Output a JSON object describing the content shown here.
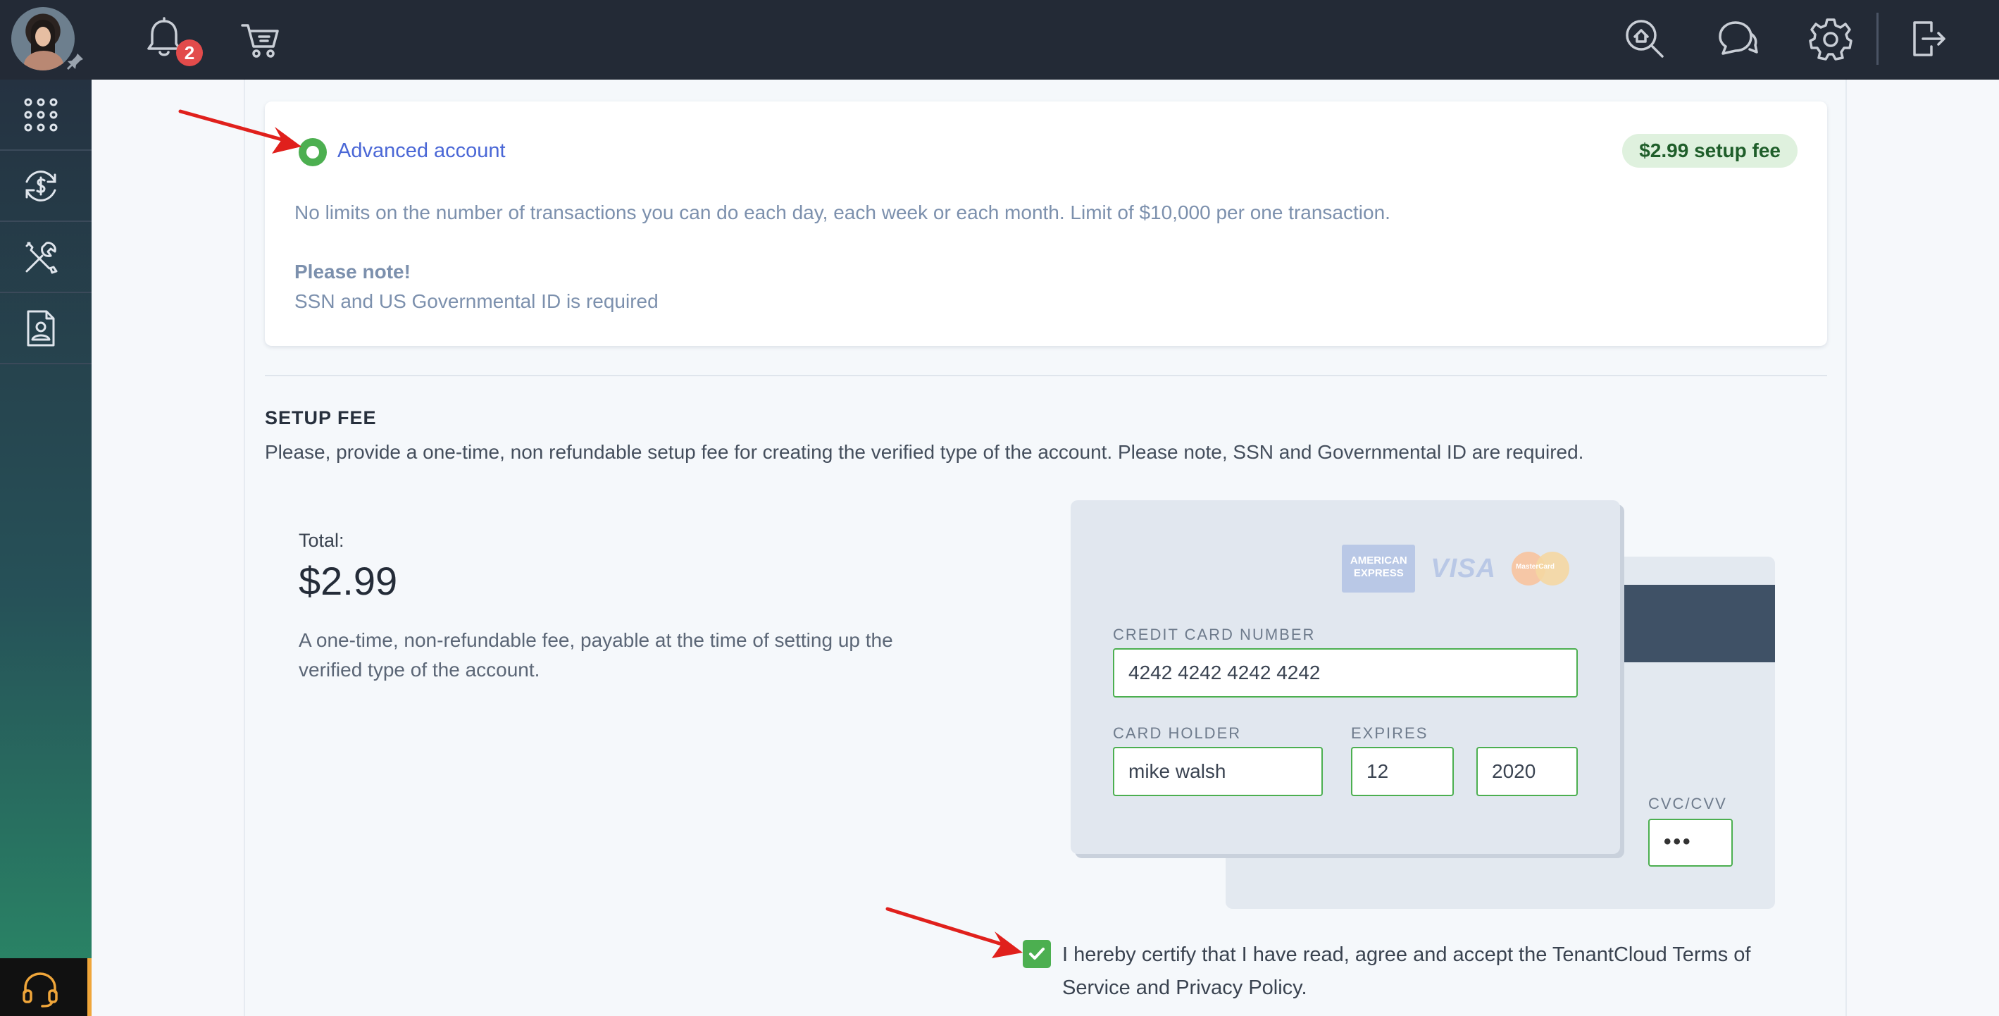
{
  "topbar": {
    "notification_count": "2",
    "icons": [
      "bell-icon",
      "cart-icon",
      "search-home-icon",
      "chat-icon",
      "gear-icon",
      "logout-icon"
    ]
  },
  "sidebar": {
    "items": [
      "apps-grid-icon",
      "payments-icon",
      "tools-icon",
      "tenant-document-icon"
    ],
    "help_icon": "headset-icon"
  },
  "account": {
    "title": "Advanced account",
    "fee_badge": "$2.99 setup fee",
    "description": "No limits on the number of transactions you can do each day, each week or each month. Limit of $10,000 per one transaction.",
    "note_title": "Please note!",
    "note_text": "SSN and US Governmental ID is required"
  },
  "setup_fee": {
    "title": "SETUP FEE",
    "description": "Please, provide a one-time, non refundable setup fee for creating the verified type of the account. Please note, SSN and Governmental ID are required.",
    "total_label": "Total:",
    "total_value": "$2.99",
    "total_description": "A one-time, non-refundable fee, payable at the time of setting up the verified type of the account."
  },
  "card": {
    "brands": {
      "amex": "AMERICAN EXPRESS",
      "visa": "VISA",
      "mastercard": "MasterCard"
    },
    "number_label": "CREDIT CARD NUMBER",
    "number_value": "4242 4242 4242 4242",
    "holder_label": "CARD HOLDER",
    "holder_value": "mike walsh",
    "expires_label": "EXPIRES",
    "expires_month": "12",
    "expires_year": "2020",
    "cvc_label": "CVC/CVV",
    "cvc_value": "•••"
  },
  "agreement": {
    "checked": true,
    "text": "I hereby certify that I have read, agree and accept the TenantCloud Terms of Service and Privacy Policy."
  },
  "colors": {
    "accent_green": "#4caf50",
    "link_blue": "#4a67d6",
    "topbar": "#232a36",
    "annotation_red": "#e0201c"
  }
}
